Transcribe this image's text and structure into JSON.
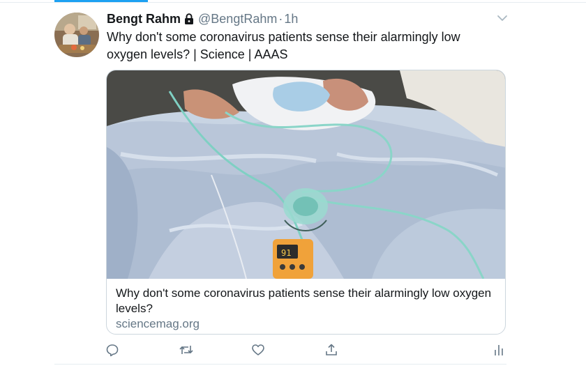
{
  "tweet": {
    "author_name": "Bengt Rahm",
    "handle": "@BengtRahm",
    "separator": "·",
    "timestamp": "1h",
    "text": "Why don't some coronavirus patients sense their alarmingly low oxygen levels? | Science | AAAS"
  },
  "card": {
    "title": "Why don't some coronavirus patients sense their alarmingly low oxygen levels?",
    "domain": "sciencemag.org",
    "oximeter_reading": "91"
  },
  "icons": {
    "lock": "lock-icon",
    "caret": "chevron-down-icon",
    "reply": "reply-icon",
    "retweet": "retweet-icon",
    "like": "heart-icon",
    "share": "share-icon",
    "analytics": "analytics-icon"
  },
  "colors": {
    "accent": "#1da1f2",
    "text": "#14171a",
    "secondary": "#657786",
    "border": "#ccd6dd"
  }
}
